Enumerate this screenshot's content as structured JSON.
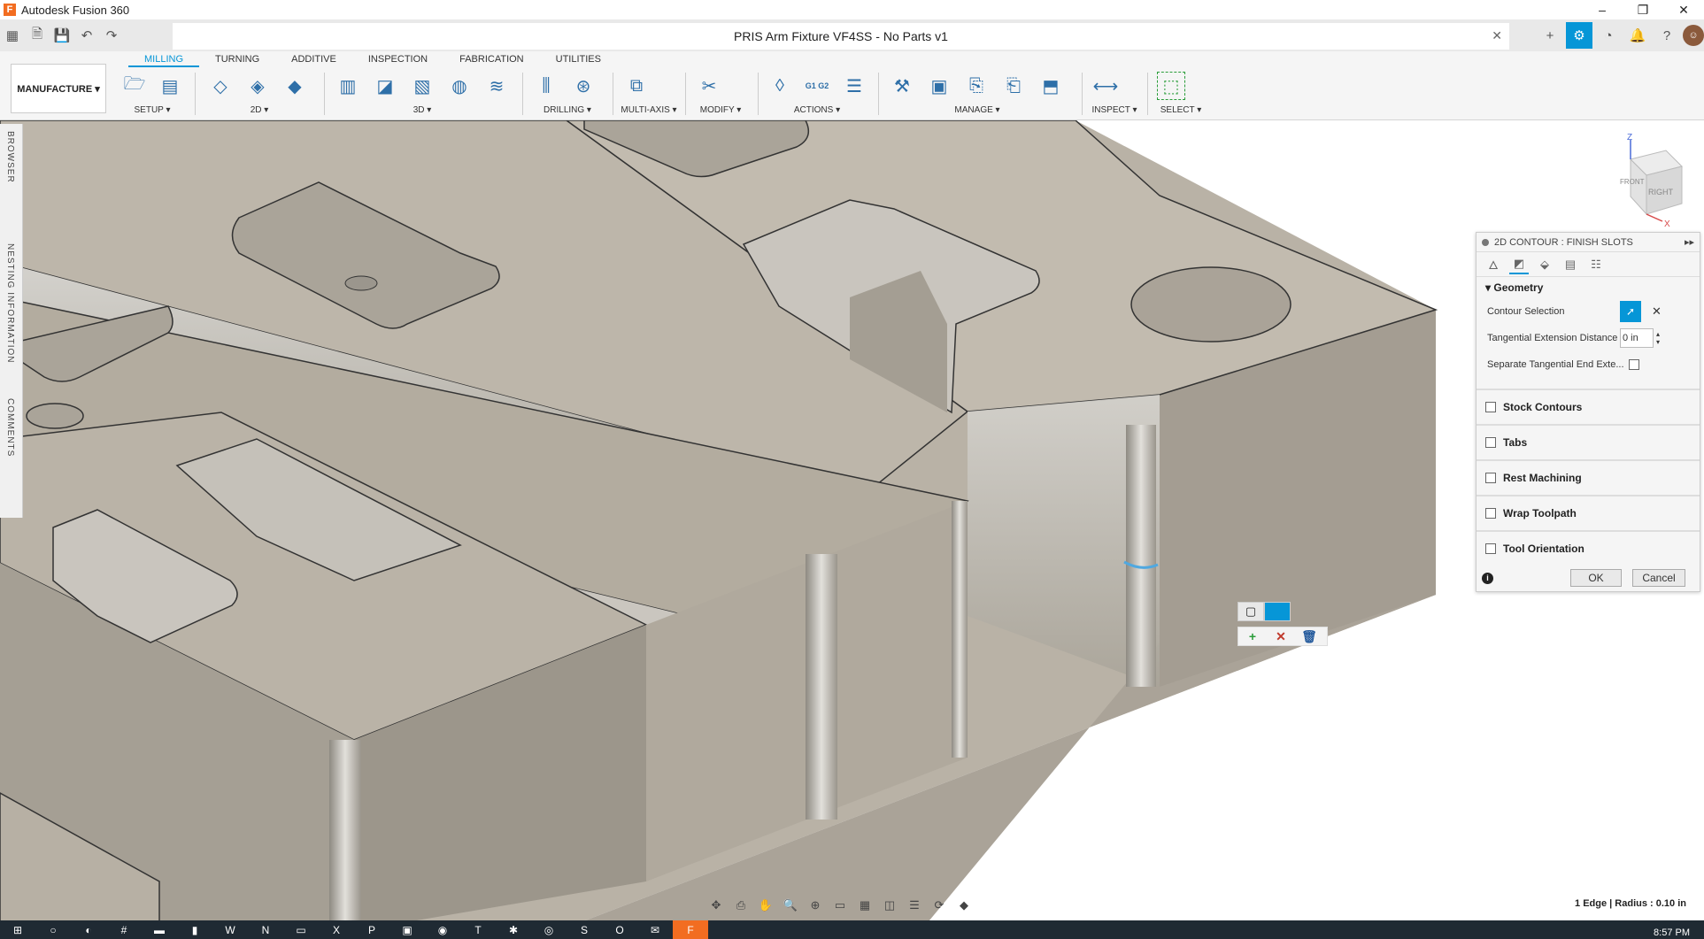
{
  "app": {
    "title": "Autodesk Fusion 360",
    "logo": "F"
  },
  "window_controls": {
    "minimize": "–",
    "restore": "❐",
    "close": "✕"
  },
  "document": {
    "title": "PRIS Arm Fixture VF4SS - No Parts v1",
    "close": "✕"
  },
  "ribbon": {
    "tabs": [
      "MILLING",
      "TURNING",
      "ADDITIVE",
      "INSPECTION",
      "FABRICATION",
      "UTILITIES"
    ],
    "selected_tab": "MILLING",
    "workspace": "MANUFACTURE ▾",
    "groups": {
      "setup": "SETUP ▾",
      "2d": "2D ▾",
      "3d": "3D ▾",
      "drilling": "DRILLING ▾",
      "multiaxis": "MULTI-AXIS ▾",
      "modify": "MODIFY ▾",
      "actions": "ACTIONS ▾",
      "manage": "MANAGE ▾",
      "inspect": "INSPECT ▾",
      "select": "SELECT ▾"
    },
    "actions_g1g2": "G1 G2"
  },
  "side_tabs": {
    "browser": "BROWSER",
    "nesting": "NESTING INFORMATION",
    "comments": "COMMENTS"
  },
  "viewcube": {
    "z": "Z",
    "x": "X",
    "front": "FRONT",
    "right": "RIGHT"
  },
  "panel": {
    "title": "2D CONTOUR : FINISH SLOTS",
    "section": "Geometry",
    "contour_selection_label": "Contour Selection",
    "tangential_extension_label": "Tangential Extension Distance",
    "tangential_extension_value": "0 in",
    "separate_tangential_label": "Separate Tangential End Exte...",
    "checks": [
      "Stock Contours",
      "Tabs",
      "Rest Machining",
      "Wrap Toolpath",
      "Tool Orientation"
    ],
    "ok": "OK",
    "cancel": "Cancel"
  },
  "status": {
    "selection": "1 Edge | Radius : 0.10 in"
  },
  "taskbar": {
    "clock": "8:57 PM"
  },
  "colors": {
    "accent": "#0696d7",
    "model": "#b9b2a6"
  }
}
